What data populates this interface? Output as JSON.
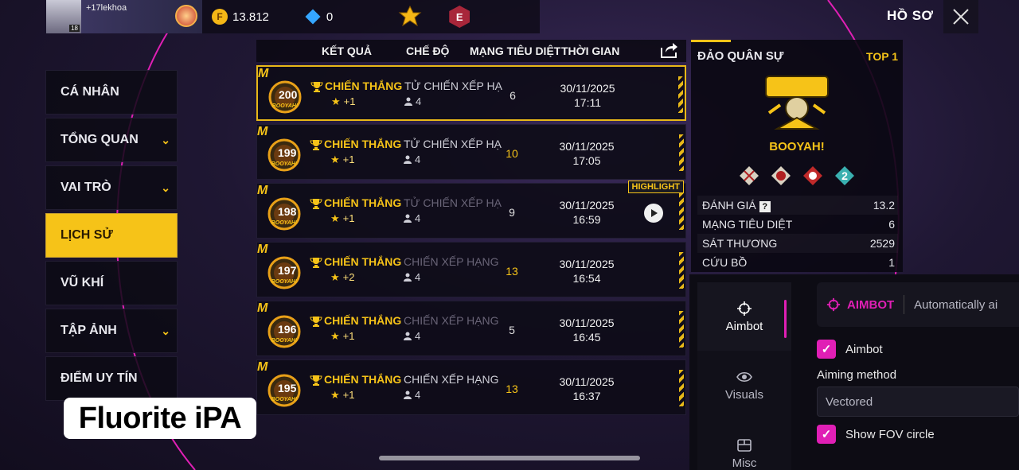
{
  "top_bar": {
    "player_name": "+17lekhoa",
    "player_level": "18",
    "gold": "13.812",
    "diamonds": "0",
    "rank_badge_letter": "E",
    "profile_label": "HỒ SƠ"
  },
  "sidebar": {
    "items": [
      {
        "label": "CÁ NHÂN",
        "has_chevron": false
      },
      {
        "label": "TỔNG QUAN",
        "has_chevron": true
      },
      {
        "label": "VAI TRÒ",
        "has_chevron": true
      },
      {
        "label": "LỊCH SỬ",
        "has_chevron": false,
        "active": true
      },
      {
        "label": "VŨ KHÍ",
        "has_chevron": false
      },
      {
        "label": "TẬP ẢNH",
        "has_chevron": true
      },
      {
        "label": "ĐIỂM UY TÍN",
        "has_chevron": false
      }
    ]
  },
  "history_header": {
    "result": "KẾT QUẢ",
    "mode": "CHẾ ĐỘ",
    "kills": "MẠNG TIÊU DIỆT",
    "time": "THỜI GIAN"
  },
  "matches": [
    {
      "number": "200",
      "result": "CHIẾN THẮNG",
      "stars": "+1",
      "mode": "TỬ CHIẾN XẾP HẠ",
      "mode_dim": false,
      "squad": "4",
      "kills": "6",
      "kills_gold": false,
      "date": "30/11/2025",
      "time": "17:11",
      "highlight": false
    },
    {
      "number": "199",
      "result": "CHIẾN THẮNG",
      "stars": "+1",
      "mode": "TỬ CHIẾN XẾP HẠ",
      "mode_dim": false,
      "squad": "4",
      "kills": "10",
      "kills_gold": true,
      "date": "30/11/2025",
      "time": "17:05",
      "highlight": false
    },
    {
      "number": "198",
      "result": "CHIẾN THẮNG",
      "stars": "+1",
      "mode": "TỬ CHIẾN XẾP HẠ",
      "mode_dim": true,
      "squad": "4",
      "kills": "9",
      "kills_gold": false,
      "date": "30/11/2025",
      "time": "16:59",
      "highlight": true
    },
    {
      "number": "197",
      "result": "CHIẾN THẮNG",
      "stars": "+2",
      "mode": "CHIẾN XẾP HẠNG",
      "mode_dim": true,
      "squad": "4",
      "kills": "13",
      "kills_gold": true,
      "date": "30/11/2025",
      "time": "16:54",
      "highlight": false
    },
    {
      "number": "196",
      "result": "CHIẾN THẮNG",
      "stars": "+1",
      "mode": "CHIẾN XẾP HẠNG",
      "mode_dim": true,
      "squad": "4",
      "kills": "5",
      "kills_gold": false,
      "date": "30/11/2025",
      "time": "16:45",
      "highlight": false
    },
    {
      "number": "195",
      "result": "CHIẾN THẮNG",
      "stars": "+1",
      "mode": "CHIẾN XẾP HẠNG",
      "mode_dim": false,
      "squad": "4",
      "kills": "13",
      "kills_gold": true,
      "date": "30/11/2025",
      "time": "16:37",
      "highlight": false
    }
  ],
  "highlight_label": "HIGHLIGHT",
  "medal_caption": "BOOYAH!",
  "detail": {
    "map_name": "ĐẢO QUÂN SỰ",
    "placement": "TOP 1",
    "booyah_label": "BOOYAH!",
    "award_count_badge": "2",
    "stats": [
      {
        "label": "ĐÁNH GIÁ",
        "value": "13.2",
        "help": true
      },
      {
        "label": "MẠNG TIÊU DIỆT",
        "value": "6",
        "help": false
      },
      {
        "label": "SÁT THƯƠNG",
        "value": "2529",
        "help": false
      },
      {
        "label": "CỨU BỒ",
        "value": "1",
        "help": false
      }
    ]
  },
  "mod_menu": {
    "tabs": [
      {
        "label": "Aimbot",
        "icon": "crosshair-icon",
        "active": true
      },
      {
        "label": "Visuals",
        "icon": "eye-icon",
        "active": false
      },
      {
        "label": "Misc",
        "icon": "box-icon",
        "active": false
      }
    ],
    "header_title": "AIMBOT",
    "header_desc": "Automatically ai",
    "aimbot_checkbox": "Aimbot",
    "aiming_method_label": "Aiming method",
    "aiming_method_value": "Vectored",
    "fov_checkbox": "Show FOV circle",
    "accent_color": "#e01fb5"
  },
  "watermark": "Fluorite iPA"
}
